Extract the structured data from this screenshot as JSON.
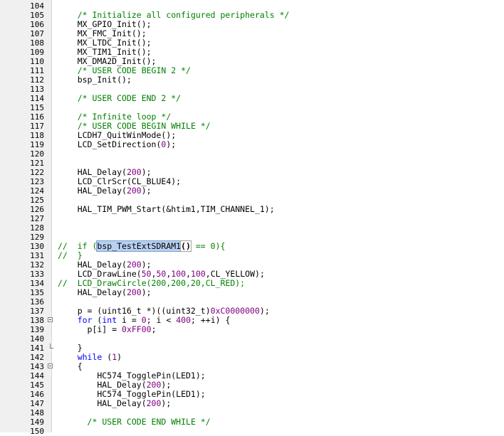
{
  "editor": {
    "lines": [
      {
        "n": "104",
        "segs": []
      },
      {
        "n": "105",
        "segs": [
          {
            "t": "    "
          },
          {
            "t": "/* Initialize all configured peripherals */",
            "c": "comment"
          }
        ]
      },
      {
        "n": "106",
        "segs": [
          {
            "t": "    MX_GPIO_Init();"
          }
        ]
      },
      {
        "n": "107",
        "segs": [
          {
            "t": "    MX_FMC_Init();"
          }
        ]
      },
      {
        "n": "108",
        "segs": [
          {
            "t": "    MX_LTDC_Init();"
          }
        ]
      },
      {
        "n": "109",
        "segs": [
          {
            "t": "    MX_TIM1_Init();"
          }
        ]
      },
      {
        "n": "110",
        "segs": [
          {
            "t": "    MX_DMA2D_Init();"
          }
        ]
      },
      {
        "n": "111",
        "segs": [
          {
            "t": "    "
          },
          {
            "t": "/* USER CODE BEGIN 2 */",
            "c": "comment"
          }
        ]
      },
      {
        "n": "112",
        "segs": [
          {
            "t": "    bsp_Init();"
          }
        ]
      },
      {
        "n": "113",
        "segs": []
      },
      {
        "n": "114",
        "segs": [
          {
            "t": "    "
          },
          {
            "t": "/* USER CODE END 2 */",
            "c": "comment"
          }
        ]
      },
      {
        "n": "115",
        "segs": []
      },
      {
        "n": "116",
        "segs": [
          {
            "t": "    "
          },
          {
            "t": "/* Infinite loop */",
            "c": "comment"
          }
        ]
      },
      {
        "n": "117",
        "segs": [
          {
            "t": "    "
          },
          {
            "t": "/* USER CODE BEGIN WHILE */",
            "c": "comment"
          }
        ]
      },
      {
        "n": "118",
        "segs": [
          {
            "t": "    LCDH7_QuitWinMode();"
          }
        ]
      },
      {
        "n": "119",
        "segs": [
          {
            "t": "    LCD_SetDirection("
          },
          {
            "t": "0",
            "c": "num"
          },
          {
            "t": ");"
          }
        ]
      },
      {
        "n": "120",
        "segs": []
      },
      {
        "n": "121",
        "segs": []
      },
      {
        "n": "122",
        "segs": [
          {
            "t": "    HAL_Delay("
          },
          {
            "t": "200",
            "c": "num"
          },
          {
            "t": ");"
          }
        ]
      },
      {
        "n": "123",
        "segs": [
          {
            "t": "    LCD_ClrScr(CL_BLUE4);"
          }
        ]
      },
      {
        "n": "124",
        "segs": [
          {
            "t": "    HAL_Delay("
          },
          {
            "t": "200",
            "c": "num"
          },
          {
            "t": ");"
          }
        ]
      },
      {
        "n": "125",
        "segs": []
      },
      {
        "n": "126",
        "segs": [
          {
            "t": "    HAL_TIM_PWM_Start(&htim1,TIM_CHANNEL_1);"
          }
        ]
      },
      {
        "n": "127",
        "segs": []
      },
      {
        "n": "128",
        "segs": []
      },
      {
        "n": "129",
        "segs": []
      },
      {
        "n": "130",
        "segs": [
          {
            "t": "//  if (",
            "c": "comment"
          },
          {
            "t": "bsp_TestExtSDRAM1",
            "c": "hl"
          },
          {
            "t": "()",
            "c": "br"
          },
          {
            "t": " == 0){",
            "c": "comment"
          }
        ]
      },
      {
        "n": "131",
        "segs": [
          {
            "t": "//  }",
            "c": "comment"
          }
        ]
      },
      {
        "n": "132",
        "segs": [
          {
            "t": "    HAL_Delay("
          },
          {
            "t": "200",
            "c": "num"
          },
          {
            "t": ");"
          }
        ]
      },
      {
        "n": "133",
        "segs": [
          {
            "t": "    LCD_DrawLine("
          },
          {
            "t": "50",
            "c": "num"
          },
          {
            "t": ","
          },
          {
            "t": "50",
            "c": "num"
          },
          {
            "t": ","
          },
          {
            "t": "100",
            "c": "num"
          },
          {
            "t": ","
          },
          {
            "t": "100",
            "c": "num"
          },
          {
            "t": ",CL_YELLOW);"
          }
        ]
      },
      {
        "n": "134",
        "segs": [
          {
            "t": "//  LCD_DrawCircle(200,200,20,CL_RED);",
            "c": "comment"
          }
        ]
      },
      {
        "n": "135",
        "segs": [
          {
            "t": "    HAL_Delay("
          },
          {
            "t": "200",
            "c": "num"
          },
          {
            "t": ");"
          }
        ]
      },
      {
        "n": "136",
        "segs": []
      },
      {
        "n": "137",
        "segs": [
          {
            "t": "    p = (uint16_t *)((uint32_t)"
          },
          {
            "t": "0xC0000000",
            "c": "num"
          },
          {
            "t": ");"
          }
        ]
      },
      {
        "n": "138",
        "fold": "open",
        "segs": [
          {
            "t": "    "
          },
          {
            "t": "for",
            "c": "kw"
          },
          {
            "t": " ("
          },
          {
            "t": "int",
            "c": "kw"
          },
          {
            "t": " i = "
          },
          {
            "t": "0",
            "c": "num"
          },
          {
            "t": "; i < "
          },
          {
            "t": "400",
            "c": "num"
          },
          {
            "t": "; ++i) {"
          }
        ]
      },
      {
        "n": "139",
        "segs": [
          {
            "t": "      p[i] = "
          },
          {
            "t": "0xFF00",
            "c": "num"
          },
          {
            "t": ";"
          }
        ]
      },
      {
        "n": "140",
        "segs": []
      },
      {
        "n": "141",
        "fold": "end",
        "segs": [
          {
            "t": "    }"
          }
        ]
      },
      {
        "n": "142",
        "segs": [
          {
            "t": "    "
          },
          {
            "t": "while",
            "c": "kw"
          },
          {
            "t": " ("
          },
          {
            "t": "1",
            "c": "num"
          },
          {
            "t": ")"
          }
        ]
      },
      {
        "n": "143",
        "fold": "open",
        "segs": [
          {
            "t": "    {"
          }
        ]
      },
      {
        "n": "144",
        "segs": [
          {
            "t": "        HC574_TogglePin(LED1);"
          }
        ]
      },
      {
        "n": "145",
        "segs": [
          {
            "t": "        HAL_Delay("
          },
          {
            "t": "200",
            "c": "num"
          },
          {
            "t": ");"
          }
        ]
      },
      {
        "n": "146",
        "segs": [
          {
            "t": "        HC574_TogglePin(LED1);"
          }
        ]
      },
      {
        "n": "147",
        "segs": [
          {
            "t": "        HAL_Delay("
          },
          {
            "t": "200",
            "c": "num"
          },
          {
            "t": ");"
          }
        ]
      },
      {
        "n": "148",
        "segs": []
      },
      {
        "n": "149",
        "segs": [
          {
            "t": "      "
          },
          {
            "t": "/* USER CODE END WHILE */",
            "c": "comment"
          }
        ]
      },
      {
        "n": "150",
        "segs": []
      }
    ]
  }
}
